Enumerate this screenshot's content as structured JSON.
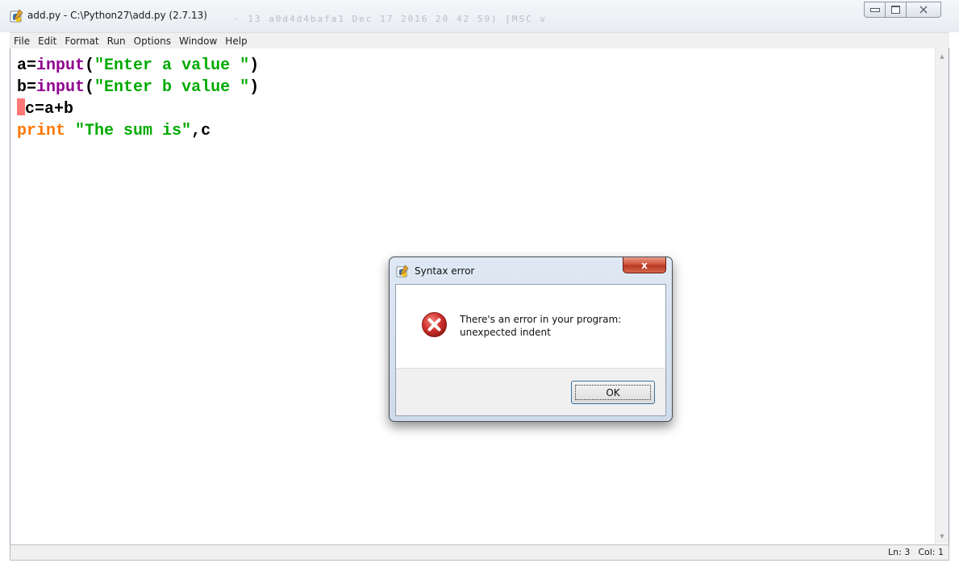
{
  "window": {
    "title": "add.py - C:\\Python27\\add.py (2.7.13)",
    "background_title_fragment": "· 13 a0d4d4bafa1 Dec 17 2016 20 42 59) [MSC v",
    "icons": {
      "app": "python-idle-icon",
      "minimize": "minimize-icon",
      "maximize": "maximize-icon",
      "close": "close-icon"
    }
  },
  "menu": {
    "items": [
      "File",
      "Edit",
      "Format",
      "Run",
      "Options",
      "Window",
      "Help"
    ]
  },
  "editor": {
    "lines": [
      {
        "tokens": [
          {
            "t": "a=",
            "k": "plain"
          },
          {
            "t": "input",
            "k": "builtin"
          },
          {
            "t": "(",
            "k": "plain"
          },
          {
            "t": "\"Enter a value \"",
            "k": "string"
          },
          {
            "t": ")",
            "k": "plain"
          }
        ]
      },
      {
        "tokens": [
          {
            "t": "b=",
            "k": "plain"
          },
          {
            "t": "input",
            "k": "builtin"
          },
          {
            "t": "(",
            "k": "plain"
          },
          {
            "t": "\"Enter b value \"",
            "k": "string"
          },
          {
            "t": ")",
            "k": "plain"
          }
        ]
      },
      {
        "error_indent": true,
        "tokens": [
          {
            "t": "c=a+b",
            "k": "plain"
          }
        ]
      },
      {
        "tokens": [
          {
            "t": "print",
            "k": "keyword"
          },
          {
            "t": " ",
            "k": "plain"
          },
          {
            "t": "\"The sum is\"",
            "k": "string"
          },
          {
            "t": ",c",
            "k": "plain"
          }
        ]
      }
    ],
    "colors": {
      "builtin": "#900090",
      "keyword": "#ff7700",
      "string": "#00aa00",
      "plain": "#000000",
      "error_highlight": "#ff7777"
    }
  },
  "status": {
    "line": "Ln: 3",
    "col": "Col: 1"
  },
  "dialog": {
    "title": "Syntax error",
    "close_label": "x",
    "message_line1": "There's an error in your program:",
    "message_line2": "unexpected indent",
    "ok_label": "OK",
    "icons": {
      "title": "python-idle-icon",
      "message": "error-icon"
    },
    "colors": {
      "error_red": "#d0312d",
      "close_red": "#c7452f"
    }
  }
}
